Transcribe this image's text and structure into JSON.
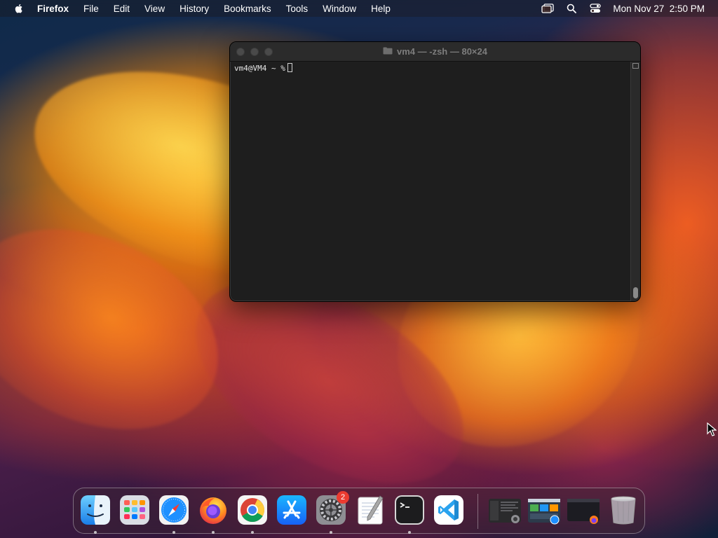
{
  "menubar": {
    "apple_icon": "apple-logo-icon",
    "app_name": "Firefox",
    "menus": [
      "File",
      "Edit",
      "View",
      "History",
      "Bookmarks",
      "Tools",
      "Window",
      "Help"
    ],
    "status_icons": [
      "screen-mirroring-icon",
      "spotlight-search-icon",
      "control-center-icon"
    ],
    "clock": "Mon Nov 27  2:50 PM"
  },
  "terminal": {
    "title": "vm4 — -zsh — 80×24",
    "prompt": "vm4@VM4 ~ %"
  },
  "dock": {
    "items": [
      {
        "name": "Finder",
        "icon": "finder-icon",
        "running": true
      },
      {
        "name": "Launchpad",
        "icon": "launchpad-icon",
        "running": false
      },
      {
        "name": "Safari",
        "icon": "safari-icon",
        "running": true
      },
      {
        "name": "Firefox",
        "icon": "firefox-icon",
        "running": true
      },
      {
        "name": "Google Chrome",
        "icon": "chrome-icon",
        "running": true
      },
      {
        "name": "App Store",
        "icon": "app-store-icon",
        "running": false
      },
      {
        "name": "System Settings",
        "icon": "system-settings-icon",
        "running": true,
        "badge": "2"
      },
      {
        "name": "TextEdit",
        "icon": "textedit-icon",
        "running": false
      },
      {
        "name": "Terminal",
        "icon": "terminal-icon",
        "running": true
      },
      {
        "name": "Visual Studio Code",
        "icon": "vscode-icon",
        "running": false
      }
    ],
    "recent": [
      "minimized-window-settings",
      "minimized-window-safari",
      "minimized-window-firefox"
    ],
    "trash": "trash-icon"
  },
  "colors": {
    "menubar_text": "#ffffff",
    "terminal_bg": "#1e1e1e",
    "badge": "#ec3b30"
  }
}
